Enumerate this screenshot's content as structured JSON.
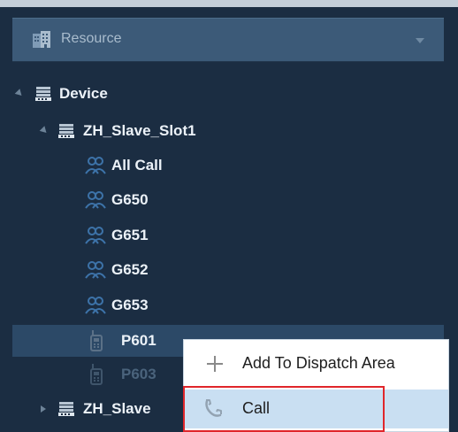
{
  "resource_dropdown": {
    "label": "Resource"
  },
  "tree": {
    "device": {
      "label": "Device"
    },
    "slot1": {
      "label": "ZH_Slave_Slot1"
    },
    "groups": [
      {
        "label": "All Call"
      },
      {
        "label": "G650"
      },
      {
        "label": "G651"
      },
      {
        "label": "G652"
      },
      {
        "label": "G653"
      }
    ],
    "terminals": [
      {
        "label": "P601",
        "selected": true
      },
      {
        "label": "P603",
        "selected": false
      }
    ],
    "slot2": {
      "label": "ZH_Slave"
    }
  },
  "context_menu": {
    "items": [
      {
        "label": "Add To Dispatch Area",
        "icon": "plus-icon"
      },
      {
        "label": "Call",
        "icon": "phone-icon",
        "highlighted": true
      }
    ]
  },
  "colors": {
    "panel_bg": "#1b2d42",
    "dropdown_bg": "#3c5a78",
    "selected_row": "#2c4967",
    "menu_highlight": "#c9dff2",
    "highlight_outline": "#e0262b",
    "group_icon": "#3d73a9",
    "terminal_icon": "#5b7187"
  }
}
